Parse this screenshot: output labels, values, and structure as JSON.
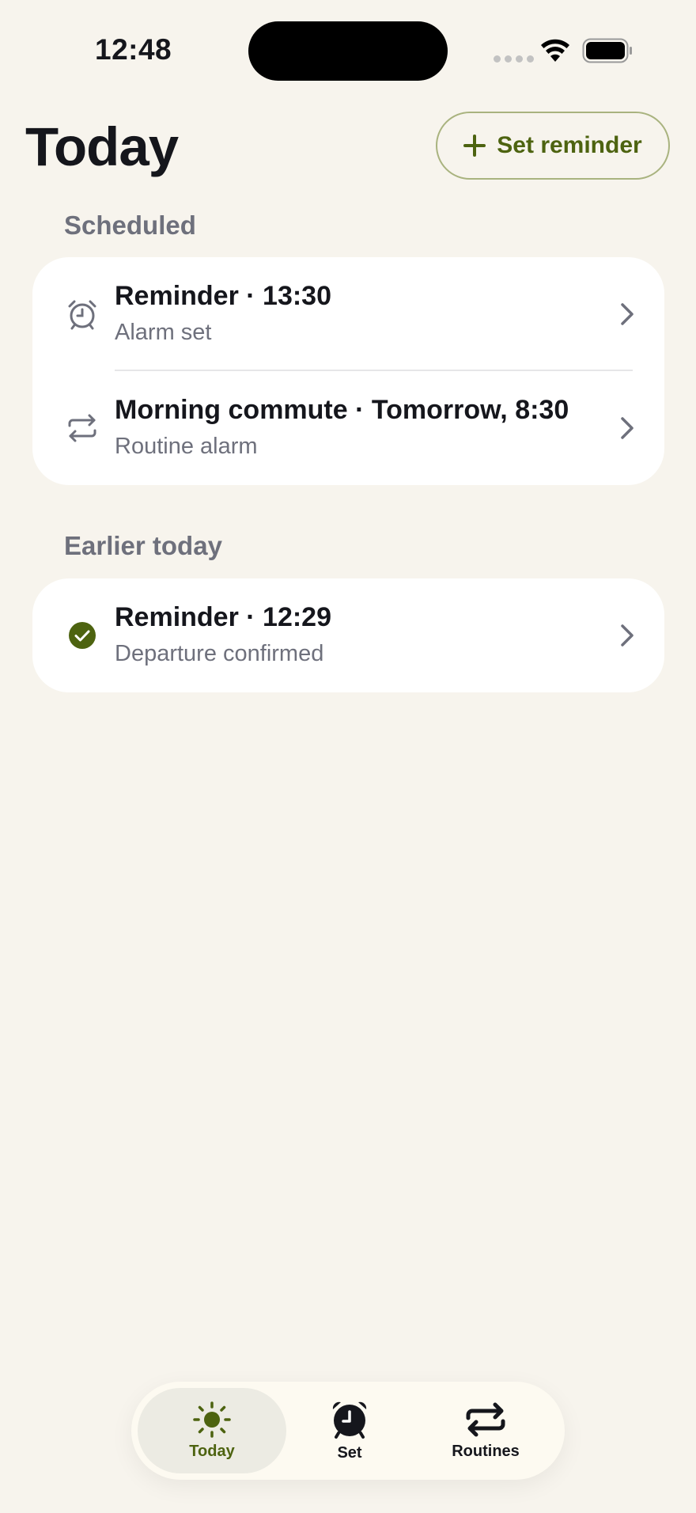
{
  "status_bar": {
    "time": "12:48"
  },
  "header": {
    "title": "Today",
    "set_reminder_label": "Set reminder"
  },
  "sections": [
    {
      "label": "Scheduled",
      "items": [
        {
          "icon": "alarm-clock-icon",
          "title": "Reminder · 13:30",
          "subtitle": "Alarm set"
        },
        {
          "icon": "repeat-icon",
          "title": "Morning commute · Tomorrow, 8:30",
          "subtitle": "Routine alarm"
        }
      ]
    },
    {
      "label": "Earlier today",
      "items": [
        {
          "icon": "check-circle-icon",
          "title": "Reminder · 12:29",
          "subtitle": "Departure confirmed"
        }
      ]
    }
  ],
  "tab_bar": {
    "tabs": [
      {
        "label": "Today",
        "icon": "sun-icon",
        "active": true
      },
      {
        "label": "Set",
        "icon": "alarm-clock-icon",
        "active": false
      },
      {
        "label": "Routines",
        "icon": "repeat-icon",
        "active": false
      }
    ]
  },
  "colors": {
    "background": "#f7f4ed",
    "accent": "#4d6310",
    "accent_border": "#a9b37f",
    "card": "#ffffff",
    "secondary_text": "#6e707c"
  }
}
